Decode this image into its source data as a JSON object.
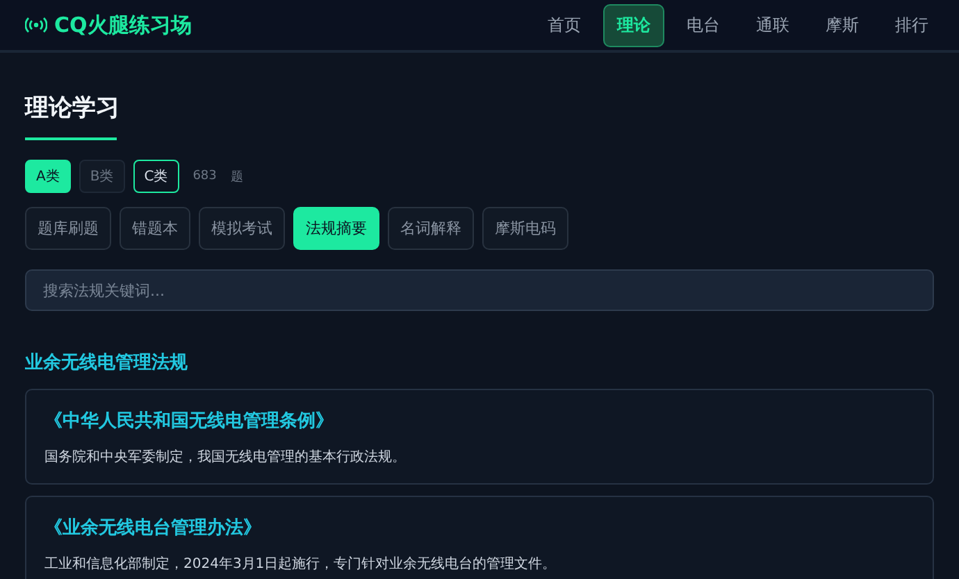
{
  "app": {
    "title": "CQ火腿练习场"
  },
  "nav": [
    {
      "label": "首页",
      "selected": false
    },
    {
      "label": "理论",
      "selected": true
    },
    {
      "label": "电台",
      "selected": false
    },
    {
      "label": "通联",
      "selected": false
    },
    {
      "label": "摩斯",
      "selected": false
    },
    {
      "label": "排行",
      "selected": false
    }
  ],
  "page_title": "理论学习",
  "classes": [
    {
      "label": "A类",
      "selected": true,
      "highlighted": false
    },
    {
      "label": "B类",
      "selected": false,
      "highlighted": false
    },
    {
      "label": "C类",
      "selected": false,
      "highlighted": true
    }
  ],
  "question_count": "683",
  "question_unit": "题",
  "tabs": [
    {
      "label": "题库刷题",
      "selected": false
    },
    {
      "label": "错题本",
      "selected": false
    },
    {
      "label": "模拟考试",
      "selected": false
    },
    {
      "label": "法规摘要",
      "selected": true
    },
    {
      "label": "名词解释",
      "selected": false
    },
    {
      "label": "摩斯电码",
      "selected": false
    }
  ],
  "search": {
    "placeholder": "搜索法规关键词..."
  },
  "section": {
    "heading": "业余无线电管理法规",
    "items": [
      {
        "title": "《中华人民共和国无线电管理条例》",
        "description": "国务院和中央军委制定，我国无线电管理的基本行政法规。"
      },
      {
        "title": "《业余无线电台管理办法》",
        "description": "工业和信息化部制定，2024年3月1日起施行，专门针对业余无线电台的管理文件。"
      }
    ]
  }
}
